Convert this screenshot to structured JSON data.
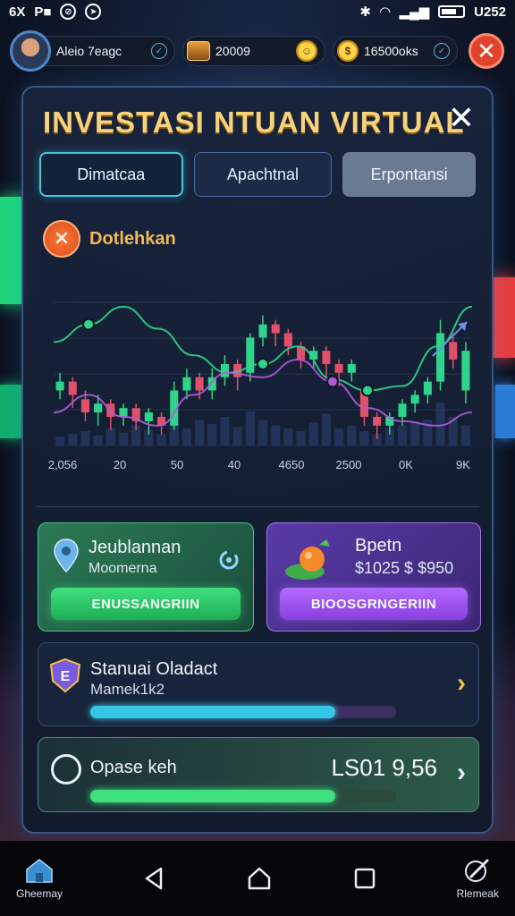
{
  "statusbar": {
    "left_items": [
      "6X",
      "P■"
    ],
    "time": "U252"
  },
  "topbar": {
    "player_name": "Aleio 7eagc",
    "coins": "20009",
    "gems": "16500oks"
  },
  "panel": {
    "title": "INVESTASI  NTUAN VIRTUAL",
    "close_glyph": "✕",
    "tabs": [
      {
        "label": "Dimatcaa"
      },
      {
        "label": "Apachtnal"
      },
      {
        "label": "Erpontansi"
      }
    ],
    "alert": {
      "icon_glyph": "✕",
      "label": "Dotlehkan"
    }
  },
  "chart_data": {
    "type": "line",
    "x_tick_labels": [
      "2,056",
      "20",
      "50",
      "40",
      "4650",
      "2500",
      "0K",
      "9K"
    ],
    "series": [
      {
        "name": "",
        "color": "#2fd48a",
        "values": [
          62,
          70,
          78,
          68,
          56,
          48,
          52,
          60,
          45,
          40,
          42,
          60,
          78
        ]
      },
      {
        "name": "",
        "color": "#b05bd8",
        "values": [
          30,
          38,
          28,
          24,
          38,
          48,
          46,
          54,
          44,
          32,
          26,
          24,
          30
        ]
      }
    ],
    "candles": [
      {
        "o": 40,
        "c": 44,
        "h": 48,
        "l": 36
      },
      {
        "o": 44,
        "c": 38,
        "h": 46,
        "l": 32
      },
      {
        "o": 36,
        "c": 30,
        "h": 40,
        "l": 26
      },
      {
        "o": 30,
        "c": 34,
        "h": 38,
        "l": 24
      },
      {
        "o": 34,
        "c": 28,
        "h": 36,
        "l": 22
      },
      {
        "o": 28,
        "c": 32,
        "h": 34,
        "l": 24
      },
      {
        "o": 32,
        "c": 26,
        "h": 34,
        "l": 22
      },
      {
        "o": 26,
        "c": 30,
        "h": 32,
        "l": 20
      },
      {
        "o": 28,
        "c": 24,
        "h": 30,
        "l": 20
      },
      {
        "o": 24,
        "c": 40,
        "h": 44,
        "l": 22
      },
      {
        "o": 40,
        "c": 46,
        "h": 50,
        "l": 36
      },
      {
        "o": 46,
        "c": 40,
        "h": 48,
        "l": 36
      },
      {
        "o": 40,
        "c": 46,
        "h": 50,
        "l": 36
      },
      {
        "o": 46,
        "c": 52,
        "h": 56,
        "l": 42
      },
      {
        "o": 52,
        "c": 46,
        "h": 54,
        "l": 40
      },
      {
        "o": 48,
        "c": 64,
        "h": 66,
        "l": 44
      },
      {
        "o": 64,
        "c": 70,
        "h": 74,
        "l": 60
      },
      {
        "o": 70,
        "c": 66,
        "h": 72,
        "l": 60
      },
      {
        "o": 66,
        "c": 60,
        "h": 68,
        "l": 56
      },
      {
        "o": 60,
        "c": 54,
        "h": 62,
        "l": 50
      },
      {
        "o": 54,
        "c": 58,
        "h": 60,
        "l": 50
      },
      {
        "o": 58,
        "c": 52,
        "h": 60,
        "l": 46
      },
      {
        "o": 52,
        "c": 48,
        "h": 54,
        "l": 42
      },
      {
        "o": 48,
        "c": 52,
        "h": 54,
        "l": 44
      },
      {
        "o": 40,
        "c": 28,
        "h": 42,
        "l": 24
      },
      {
        "o": 28,
        "c": 24,
        "h": 30,
        "l": 18
      },
      {
        "o": 24,
        "c": 28,
        "h": 30,
        "l": 20
      },
      {
        "o": 28,
        "c": 34,
        "h": 36,
        "l": 24
      },
      {
        "o": 34,
        "c": 38,
        "h": 40,
        "l": 30
      },
      {
        "o": 38,
        "c": 44,
        "h": 46,
        "l": 34
      },
      {
        "o": 44,
        "c": 66,
        "h": 72,
        "l": 40
      },
      {
        "o": 62,
        "c": 54,
        "h": 66,
        "l": 50
      },
      {
        "o": 40,
        "c": 58,
        "h": 62,
        "l": 34
      }
    ],
    "volumes": [
      6,
      8,
      10,
      7,
      12,
      9,
      14,
      11,
      8,
      16,
      12,
      18,
      15,
      20,
      13,
      24,
      18,
      14,
      12,
      10,
      16,
      22,
      12,
      14,
      10,
      8,
      12,
      14,
      16,
      18,
      30,
      20,
      14
    ],
    "nodes": [
      {
        "series": 0,
        "index": 1
      },
      {
        "series": 0,
        "index": 6
      },
      {
        "series": 0,
        "index": 9
      },
      {
        "series": 1,
        "index": 8
      }
    ]
  },
  "cards": {
    "left": {
      "title": "Jeublannan",
      "subtitle": "Moomerna",
      "button": "ENUSSANGRIIN"
    },
    "right": {
      "title": "Bpetn",
      "subtitle": "$1025 $ $950",
      "button": "BIOOSGRNGERIIN"
    }
  },
  "progress_rows": [
    {
      "title": "Stanuai Oladact",
      "subtitle": "Mamek1k2",
      "progress": 0.8,
      "color": "#35c6e6",
      "track": "#3a2f5e"
    },
    {
      "title": "Opase keh",
      "amount": "LS01  9,56",
      "progress": 0.8,
      "color": "#3fe07e",
      "track": "#2a4a3a"
    }
  ],
  "bottomnav": {
    "left_label": "Gheemay",
    "right_label": "Rlemeak"
  },
  "colors": {
    "accent": "#43c7d9",
    "title": "#f7d27a",
    "danger": "#e0432d"
  }
}
